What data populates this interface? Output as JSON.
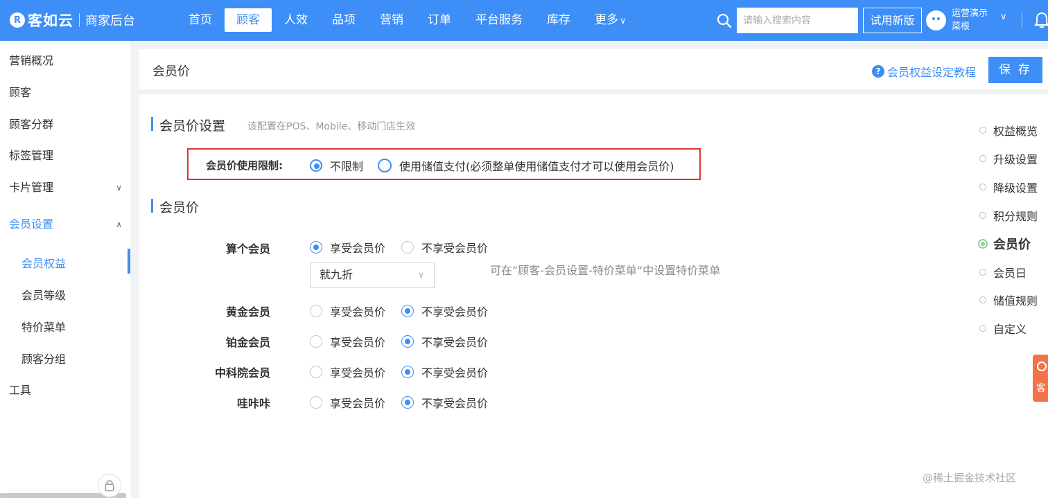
{
  "app": {
    "logo_mark": "R",
    "logo_text": "客如云",
    "logo_sub": "商家后台"
  },
  "nav": {
    "items": [
      "首页",
      "顾客",
      "人效",
      "品项",
      "营销",
      "订单",
      "平台服务",
      "库存",
      "更多"
    ],
    "active": "顾客",
    "more_caret": "∨"
  },
  "search": {
    "placeholder": "请输入搜索内容"
  },
  "trial_button": "试用新版",
  "user": {
    "line1": "运营演示",
    "line2": "菜根",
    "caret": "∨"
  },
  "sidebar": {
    "items": [
      {
        "label": "营销概况"
      },
      {
        "label": "顾客"
      },
      {
        "label": "顾客分群"
      },
      {
        "label": "标签管理"
      },
      {
        "label": "卡片管理",
        "chevron": "∨"
      },
      {
        "label": "会员设置",
        "chevron": "∧"
      },
      {
        "label": "会员权益"
      },
      {
        "label": "会员等级"
      },
      {
        "label": "特价菜单"
      },
      {
        "label": "顾客分组"
      },
      {
        "label": "工具"
      }
    ],
    "active_item": "会员权益",
    "open_group": "会员设置"
  },
  "header": {
    "title": "会员价",
    "help_icon": "?",
    "help_link": "会员权益设定教程",
    "save_label": "保 存"
  },
  "settings_section": {
    "title": "会员价设置",
    "note": "该配置在POS、Mobile、移动门店生效",
    "limit_label": "会员价使用限制:",
    "options": [
      "不限制",
      "使用储值支付(必须整单使用储值支付才可以使用会员价)"
    ],
    "selected": "不限制"
  },
  "price_section": {
    "title": "会员价",
    "option_yes": "享受会员价",
    "option_no": "不享受会员价",
    "rows": [
      {
        "label": "算个会员",
        "selected": "享受会员价"
      },
      {
        "label": "黄金会员",
        "selected": "不享受会员价"
      },
      {
        "label": "铂金会员",
        "selected": "不享受会员价"
      },
      {
        "label": "中科院会员",
        "selected": "不享受会员价"
      },
      {
        "label": "哇咔咔",
        "selected": "不享受会员价"
      }
    ],
    "discount_select": {
      "value": "就九折",
      "chevron": "∨"
    },
    "hint": "可在”顾客-会员设置-特价菜单“中设置特价菜单"
  },
  "anchors": {
    "items": [
      "权益概览",
      "升级设置",
      "降级设置",
      "积分规则",
      "会员价",
      "会员日",
      "储值规则",
      "自定义"
    ],
    "active": "会员价"
  },
  "service_tab": "客",
  "watermark": "@稀土掘金技术社区",
  "colors": {
    "primary": "#3d8ef7",
    "highlight_border": "#dd3333",
    "anchor_active": "#8ed39a",
    "service_tab": "#f0734a"
  }
}
